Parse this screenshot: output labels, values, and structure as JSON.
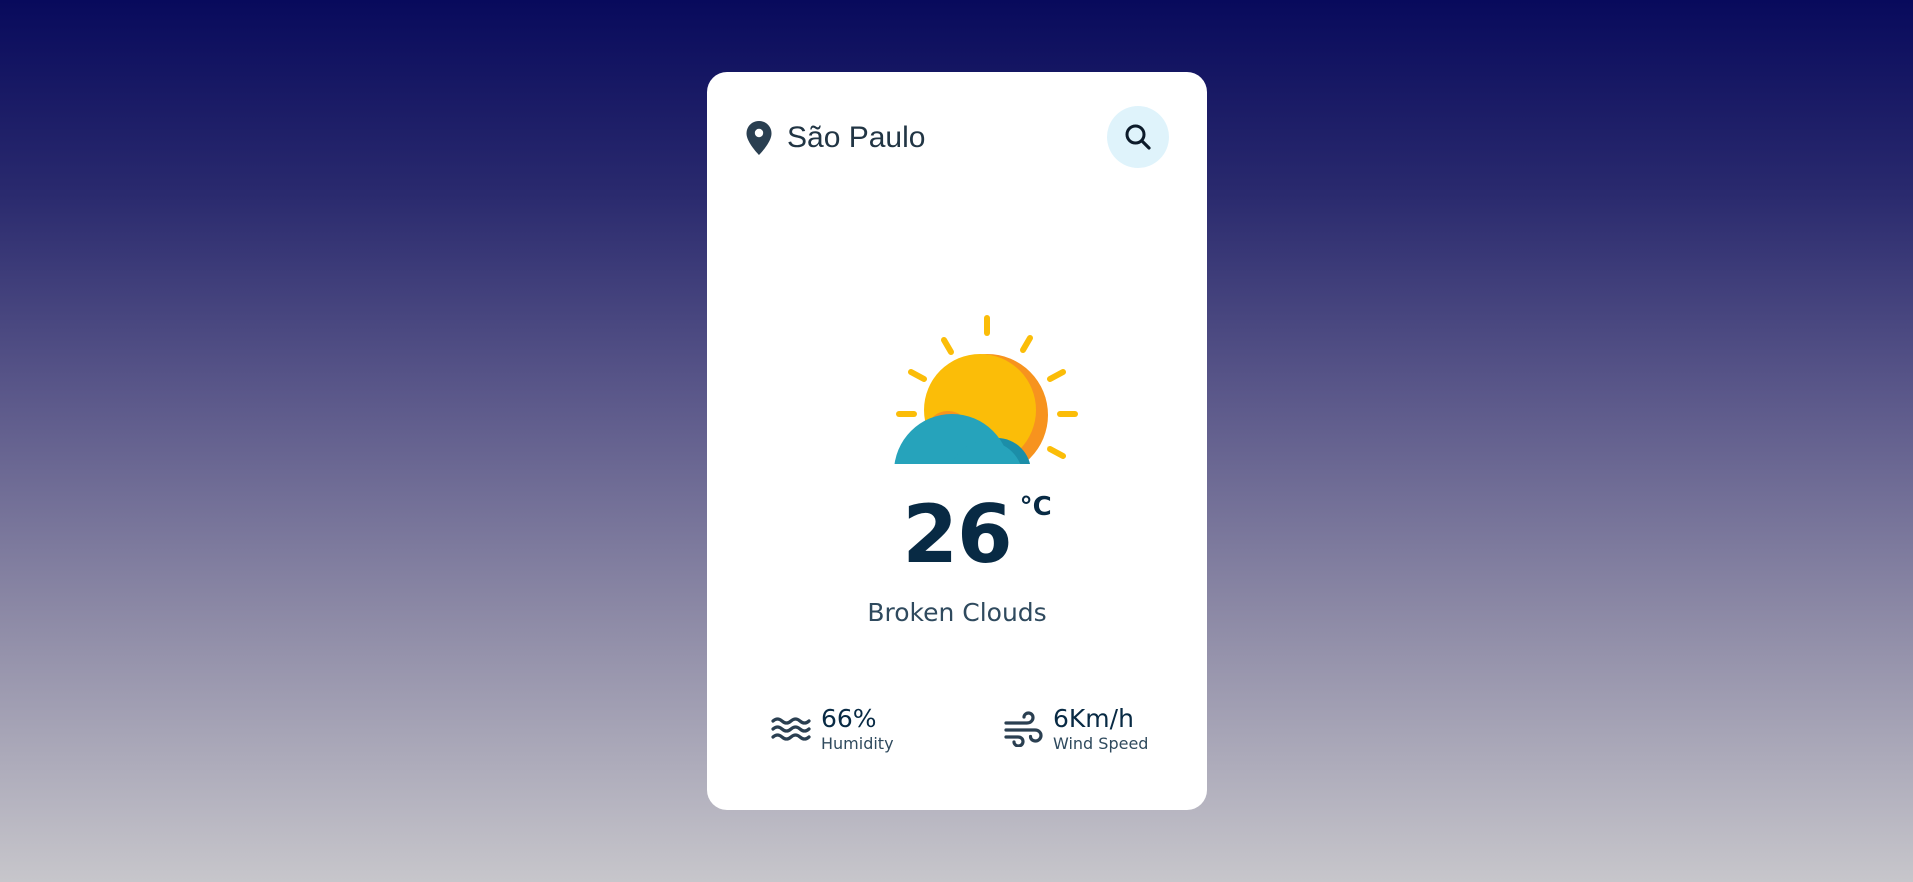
{
  "location": {
    "city": "São Paulo",
    "icon": "map-pin-icon"
  },
  "search": {
    "icon": "search-icon"
  },
  "weather": {
    "icon": "sun-behind-cloud-icon",
    "temperature": "26",
    "unit": "°C",
    "description": "Broken Clouds"
  },
  "details": {
    "humidity": {
      "value": "66%",
      "label": "Humidity",
      "icon": "humidity-waves-icon"
    },
    "wind": {
      "value": "6Km/h",
      "label": "Wind Speed",
      "icon": "wind-icon"
    }
  },
  "colors": {
    "card_background": "#ffffff",
    "primary_text": "#082a44",
    "secondary_text": "#2f4a5e",
    "search_button_bg": "#dff3fb",
    "sun": "#fbbd08",
    "sun_shadow": "#f7931e",
    "cloud": "#26a3bb",
    "cloud_shadow": "#1c8ea8"
  }
}
